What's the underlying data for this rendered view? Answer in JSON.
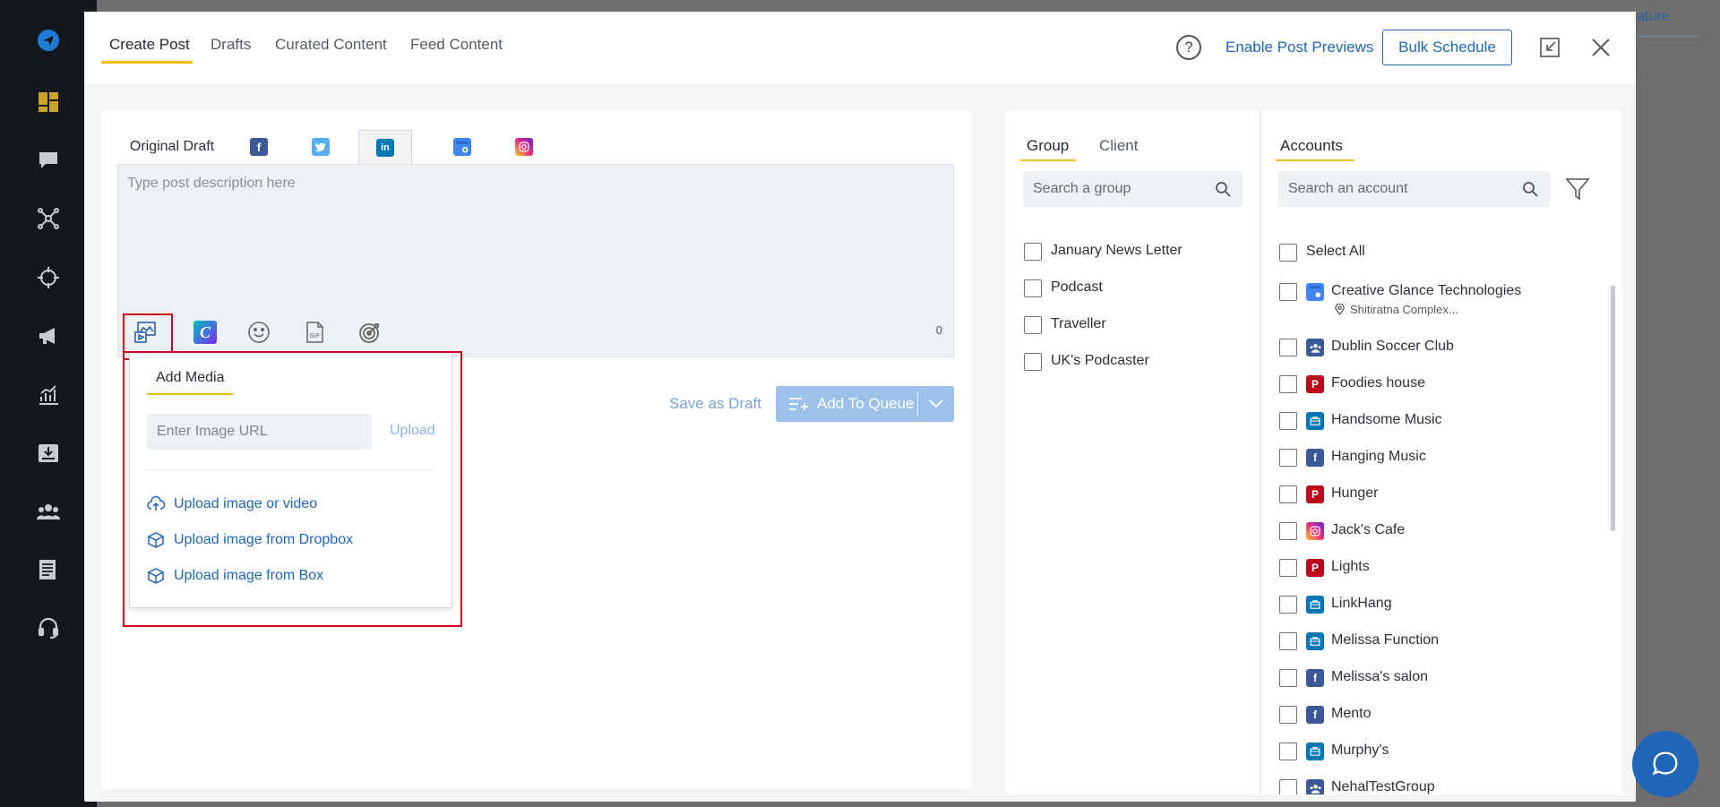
{
  "background": {
    "link_text": "eature"
  },
  "header": {
    "tabs": [
      {
        "label": "Create Post"
      },
      {
        "label": "Drafts"
      },
      {
        "label": "Curated Content"
      },
      {
        "label": "Feed Content"
      }
    ],
    "help_glyph": "?",
    "enable_previews": "Enable Post Previews",
    "bulk_schedule": "Bulk Schedule"
  },
  "editor": {
    "tabs": [
      {
        "label": "Original Draft"
      },
      {
        "icon": "facebook-icon",
        "color": "#3b5998"
      },
      {
        "icon": "twitter-icon",
        "color": "#55acee"
      },
      {
        "icon": "linkedin-icon",
        "color": "#0077b5"
      },
      {
        "icon": "google-business-icon",
        "color": "#4285f4"
      },
      {
        "icon": "instagram-icon",
        "color": "#d6249f"
      }
    ],
    "placeholder": "Type post description here",
    "char_count": "0",
    "save_draft": "Save as Draft",
    "add_to_queue": "Add To Queue"
  },
  "media": {
    "title": "Add Media",
    "url_placeholder": "Enter Image URL",
    "upload": "Upload",
    "options": [
      {
        "label": "Upload image or video",
        "icon": "cloud-upload-icon"
      },
      {
        "label": "Upload image from Dropbox",
        "icon": "dropbox-icon"
      },
      {
        "label": "Upload image from Box",
        "icon": "box-icon"
      }
    ]
  },
  "groups": {
    "tabs": [
      {
        "label": "Group"
      },
      {
        "label": "Client"
      }
    ],
    "search_placeholder": "Search a group",
    "items": [
      {
        "label": "January News Letter"
      },
      {
        "label": "Podcast"
      },
      {
        "label": "Traveller"
      },
      {
        "label": "UK's Podcaster"
      }
    ]
  },
  "accounts": {
    "tab": "Accounts",
    "search_placeholder": "Search an account",
    "select_all": "Select All",
    "items": [
      {
        "label": "Creative Glance Technologies",
        "network": "google-business",
        "sub": "Shitiratna Complex..."
      },
      {
        "label": "Dublin Soccer Club",
        "network": "facebook-group"
      },
      {
        "label": "Foodies house",
        "network": "pinterest"
      },
      {
        "label": "Handsome Music",
        "network": "linkedin-page"
      },
      {
        "label": "Hanging Music",
        "network": "facebook"
      },
      {
        "label": "Hunger",
        "network": "pinterest"
      },
      {
        "label": "Jack's Cafe",
        "network": "instagram"
      },
      {
        "label": "Lights",
        "network": "pinterest"
      },
      {
        "label": "LinkHang",
        "network": "linkedin-page"
      },
      {
        "label": "Melissa Function",
        "network": "linkedin-page"
      },
      {
        "label": "Melissa's salon",
        "network": "facebook"
      },
      {
        "label": "Mento",
        "network": "facebook"
      },
      {
        "label": "Murphy's",
        "network": "linkedin-page"
      },
      {
        "label": "NehalTestGroup",
        "network": "facebook-group"
      }
    ]
  },
  "colors": {
    "accent": "#f1bd1a",
    "link": "#1f66b8",
    "nav_bg": "#14181d",
    "highlight": "#d0021b"
  }
}
